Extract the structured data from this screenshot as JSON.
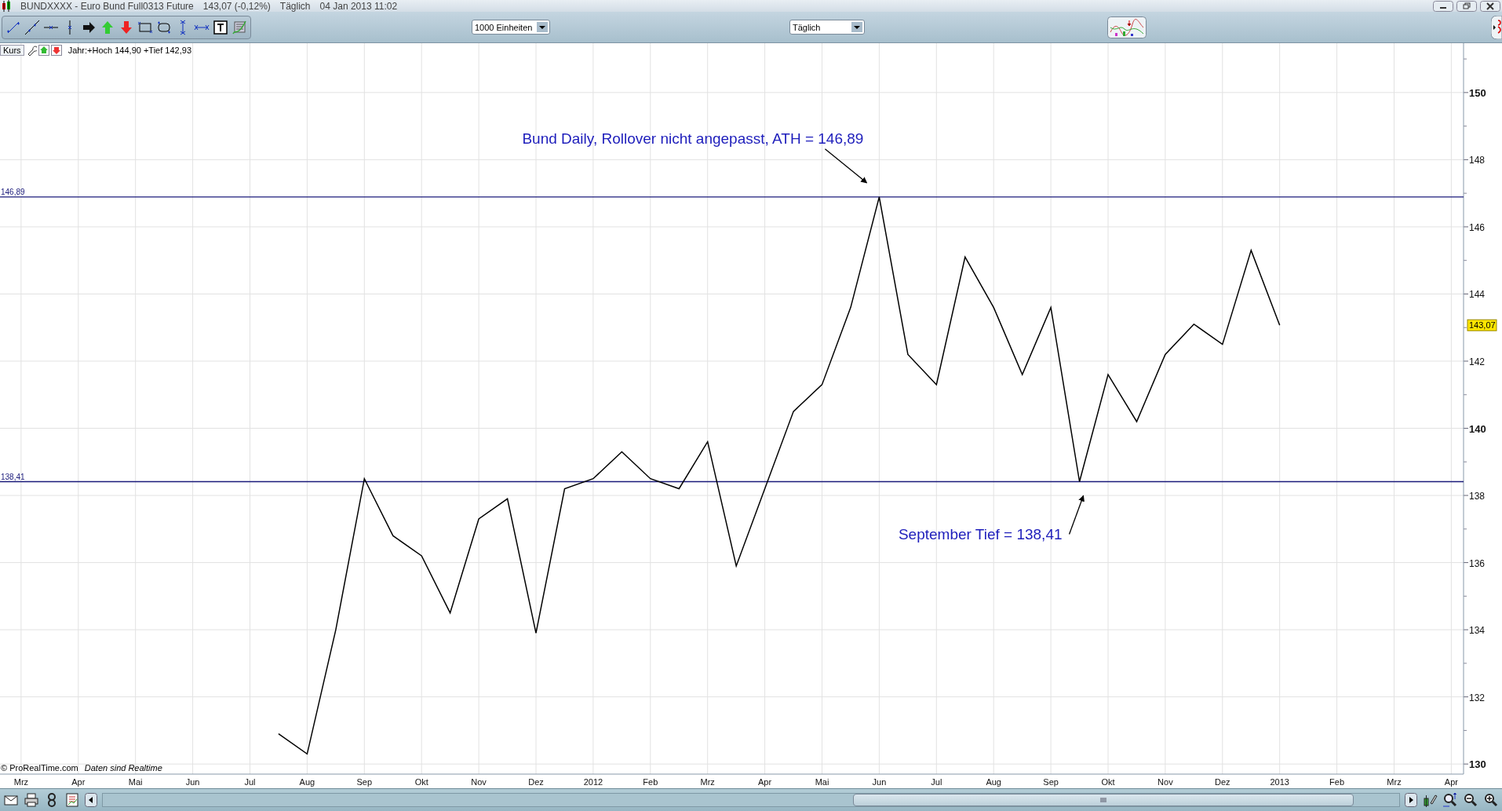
{
  "window": {
    "title": "BUNDXXXX - Euro Bund Full0313 Future",
    "quote": "143,07 (-0,12%)",
    "period": "Täglich",
    "timestamp": "04 Jan 2013 11:02"
  },
  "toolbar": {
    "units_dropdown": {
      "value": "1000 Einheiten"
    },
    "period_dropdown": {
      "value": "Täglich"
    }
  },
  "chart_header": {
    "info": "Jahr:+Hoch 144,90 +Tief 142,93"
  },
  "chart_footer": {
    "source": "© ProRealTime.com",
    "note": "Daten sind Realtime"
  },
  "chart": {
    "last_price": "143,07",
    "chart_data": {
      "type": "line",
      "categories": [
        "Mrz",
        null,
        "Apr",
        null,
        "Mai",
        null,
        "Jun",
        null,
        "Jul",
        null,
        "Aug",
        null,
        "Sep",
        null,
        "Okt",
        null,
        "Nov",
        null,
        "Dez",
        null,
        "2012",
        null,
        "Feb",
        null,
        "Mrz",
        null,
        "Apr",
        null,
        "Mai",
        null,
        "Jun",
        null,
        "Jul",
        null,
        "Aug",
        null,
        "Sep",
        null,
        "Okt",
        null,
        "Nov",
        null,
        "Dez",
        null,
        "2013",
        null,
        "Feb",
        null,
        "Mrz",
        null,
        "Apr"
      ],
      "series": [
        {
          "name": "Kurs",
          "color": "#000000",
          "values": [
            null,
            null,
            null,
            null,
            null,
            null,
            null,
            null,
            null,
            130.9,
            130.3,
            134,
            138.5,
            136.8,
            136.2,
            134.5,
            137.3,
            137.9,
            133.9,
            138.2,
            138.5,
            139.3,
            138.5,
            138.2,
            139.6,
            135.9,
            138.2,
            140.5,
            141.3,
            143.6,
            146.89,
            142.2,
            141.3,
            145.1,
            143.6,
            141.6,
            143.6,
            138.41,
            141.6,
            140.2,
            142.2,
            143.1,
            142.5,
            145.3,
            143.07,
            null,
            null,
            null,
            null,
            null,
            null
          ]
        }
      ],
      "ylim": [
        129.7,
        151.47
      ],
      "yticks": [
        130,
        132,
        134,
        136,
        138,
        140,
        142,
        144,
        146,
        148,
        150
      ],
      "grid": true,
      "ref_lines": [
        {
          "axis": "y",
          "value": 146.89,
          "label": "146,89",
          "color": "#1a1a7a"
        },
        {
          "axis": "y",
          "value": 138.41,
          "label": "138,41",
          "color": "#1a1a7a"
        }
      ],
      "annotations": [
        "Bund Daily, Rollover nicht angepasst, ATH = 146,89",
        "September Tief = 138,41"
      ]
    }
  }
}
